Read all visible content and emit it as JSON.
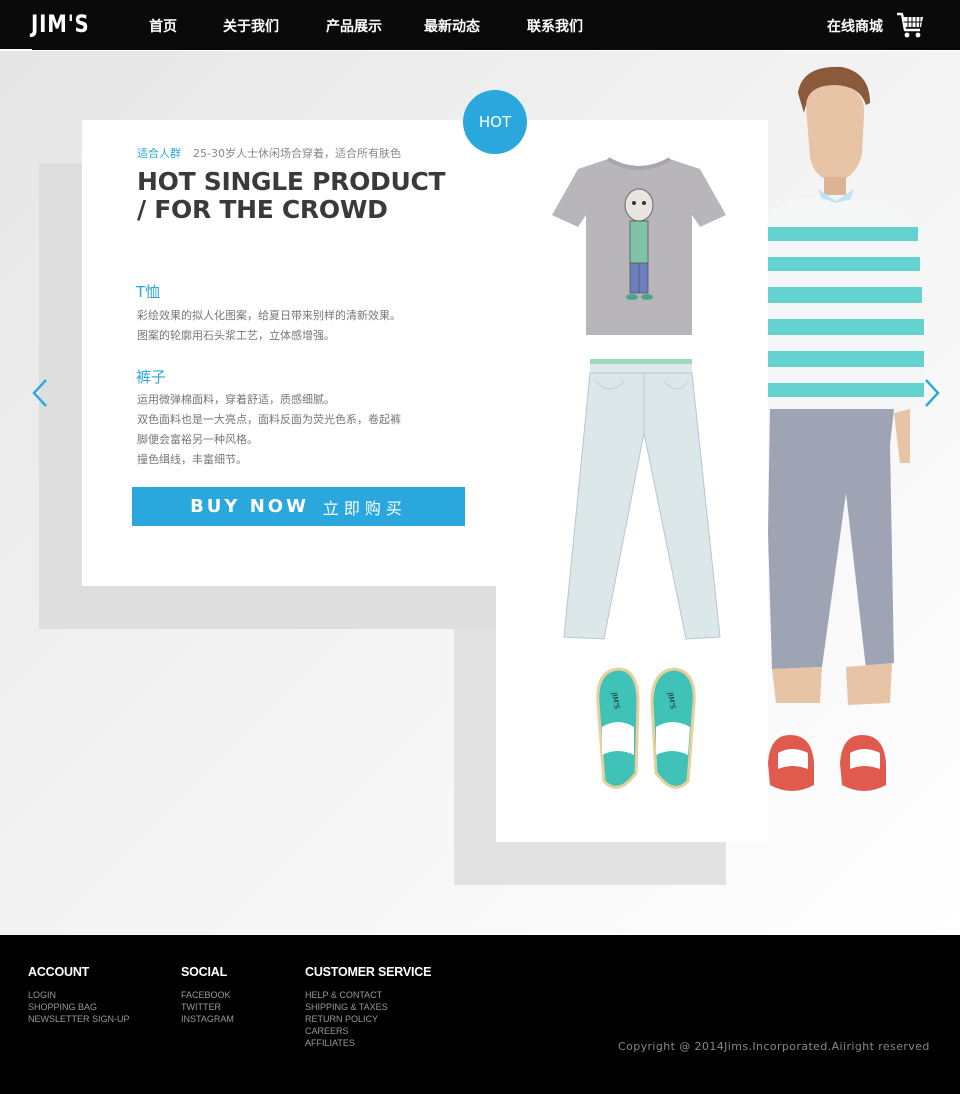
{
  "header": {
    "logo": "JIM'S",
    "nav": [
      "首页",
      "关于我们",
      "产品展示",
      "最新动态",
      "联系我们"
    ],
    "shop_label": "在线商城",
    "cart_icon": "shopping-cart-icon"
  },
  "hero": {
    "audience_label": "适合人群",
    "audience_text": "25-30岁人士休闲场合穿着，适合所有肤色",
    "headline_line1": "HOT SINGLE PRODUCT",
    "headline_line2": "/ FOR THE CROWD",
    "badge": "HOT",
    "tshirt": {
      "title": "T恤",
      "lines": [
        "彩绘效果的拟人化图案，给夏日带来别样的清新效果。",
        "图案的轮廓用石头浆工艺，立体感增强。"
      ]
    },
    "pants": {
      "title": "裤子",
      "lines": [
        "运用微弹棉面料，穿着舒适，质感细腻。",
        "双色面料也是一大亮点，面料反面为荧光色系，卷起裤",
        "脚便会富裕另一种风格。",
        "撞色缉线，丰富细节。"
      ]
    },
    "buy_en": "BUY NOW",
    "buy_cn": "立即购买",
    "shoe_brand": "JIM'S"
  },
  "footer": {
    "account": {
      "title": "ACCOUNT",
      "links": [
        "LOGIN",
        "SHOPPING BAG",
        "NEWSLETTER SIGN-UP"
      ]
    },
    "social": {
      "title": "SOCIAL",
      "links": [
        "FACEBOOK",
        "TWITTER",
        "INSTAGRAM"
      ]
    },
    "service": {
      "title": "CUSTOMER SERVICE",
      "links": [
        "HELP & CONTACT",
        "SHIPPING & TAXES",
        "RETURN POLICY",
        "CAREERS",
        "AFFILIATES"
      ]
    },
    "copyright": "Copyright @ 2014Jims.Incorporated.Aiiright reserved"
  },
  "colors": {
    "accent": "#2aa7dd",
    "header_bg": "#0a0a0a",
    "footer_bg": "#000000",
    "heading": "#3a3a3a"
  }
}
